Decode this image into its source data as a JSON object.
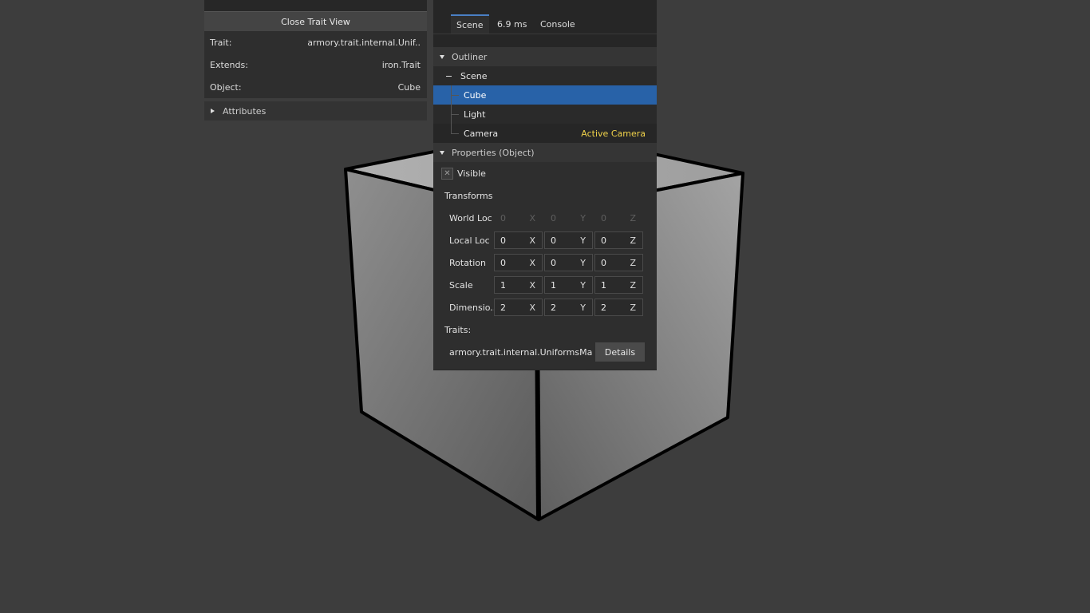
{
  "trait_view": {
    "close_label": "Close Trait View",
    "rows": [
      {
        "key": "Trait:",
        "value": "armory.trait.internal.Unif.."
      },
      {
        "key": "Extends:",
        "value": "iron.Trait"
      },
      {
        "key": "Object:",
        "value": "Cube"
      }
    ],
    "attributes_label": "Attributes"
  },
  "tabs": [
    {
      "label": "Scene",
      "active": true
    },
    {
      "label": "6.9 ms",
      "active": false
    },
    {
      "label": "Console",
      "active": false
    }
  ],
  "outliner": {
    "header": "Outliner",
    "root": "Scene",
    "items": [
      {
        "label": "Cube",
        "selected": true,
        "tag": ""
      },
      {
        "label": "Light",
        "selected": false,
        "tag": ""
      },
      {
        "label": "Camera",
        "selected": false,
        "tag": "Active Camera"
      }
    ]
  },
  "properties": {
    "header": "Properties (Object)",
    "visible_label": "Visible",
    "visible_checked": true,
    "transforms_label": "Transforms",
    "rows": [
      {
        "label": "World Loc",
        "x": "0",
        "y": "0",
        "z": "0",
        "disabled": true
      },
      {
        "label": "Local Loc",
        "x": "0",
        "y": "0",
        "z": "0",
        "disabled": false
      },
      {
        "label": "Rotation",
        "x": "0",
        "y": "0",
        "z": "0",
        "disabled": false
      },
      {
        "label": "Scale",
        "x": "1",
        "y": "1",
        "z": "1",
        "disabled": false
      },
      {
        "label": "Dimensio..",
        "x": "2",
        "y": "2",
        "z": "2",
        "disabled": false
      }
    ],
    "axis_labels": [
      "X",
      "Y",
      "Z"
    ],
    "traits_label": "Traits:",
    "trait_name": "armory.trait.internal.UniformsMana..",
    "details_label": "Details"
  },
  "colors": {
    "background": "#3d3d3d",
    "selected": "#2862a8",
    "active_camera": "#f0d24a"
  },
  "icons": [
    "collapse-triangle-icon",
    "expand-triangle-icon",
    "checkbox-x-icon"
  ]
}
